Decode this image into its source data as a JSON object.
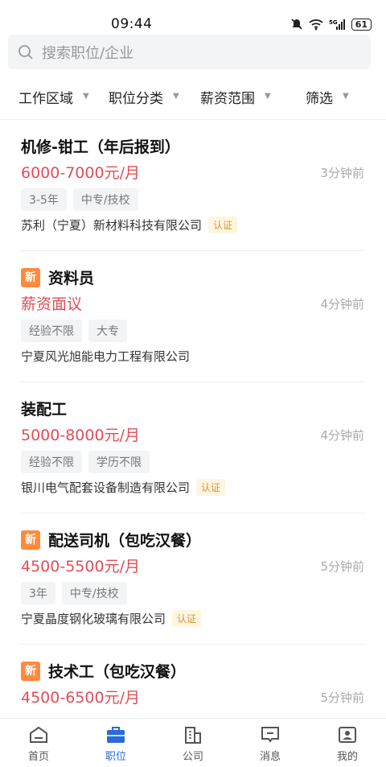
{
  "status_bar": {
    "time": "09:44",
    "battery": "61"
  },
  "search": {
    "placeholder": "搜索职位/企业"
  },
  "filters": [
    {
      "label": "工作区域"
    },
    {
      "label": "职位分类"
    },
    {
      "label": "薪资范围"
    },
    {
      "label": "筛选"
    }
  ],
  "jobs": [
    {
      "is_new": false,
      "title": "机修-钳工（年后报到）",
      "salary": "6000-7000元/月",
      "time": "3分钟前",
      "tags": [
        "3-5年",
        "中专/技校"
      ],
      "company": "苏利（宁夏）新材料科技有限公司",
      "verified": true,
      "verified_label": "认证"
    },
    {
      "is_new": true,
      "new_label": "新",
      "title": "资料员",
      "salary": "薪资面议",
      "time": "4分钟前",
      "tags": [
        "经验不限",
        "大专"
      ],
      "company": "宁夏风光旭能电力工程有限公司",
      "verified": false
    },
    {
      "is_new": false,
      "title": "装配工",
      "salary": "5000-8000元/月",
      "time": "4分钟前",
      "tags": [
        "经验不限",
        "学历不限"
      ],
      "company": "银川电气配套设备制造有限公司",
      "verified": true,
      "verified_label": "认证"
    },
    {
      "is_new": true,
      "new_label": "新",
      "title": "配送司机（包吃汉餐）",
      "salary": "4500-5500元/月",
      "time": "5分钟前",
      "tags": [
        "3年",
        "中专/技校"
      ],
      "company": "宁夏晶度钢化玻璃有限公司",
      "verified": true,
      "verified_label": "认证"
    },
    {
      "is_new": true,
      "new_label": "新",
      "title": "技术工（包吃汉餐）",
      "salary": "4500-6500元/月",
      "time": "5分钟前"
    }
  ],
  "nav": [
    {
      "label": "首页",
      "active": false
    },
    {
      "label": "职位",
      "active": true
    },
    {
      "label": "公司",
      "active": false
    },
    {
      "label": "消息",
      "active": false
    },
    {
      "label": "我的",
      "active": false
    }
  ],
  "colors": {
    "accent": "#2a6bd6",
    "salary": "#e34d59",
    "new_badge": "#ff8a3d"
  }
}
